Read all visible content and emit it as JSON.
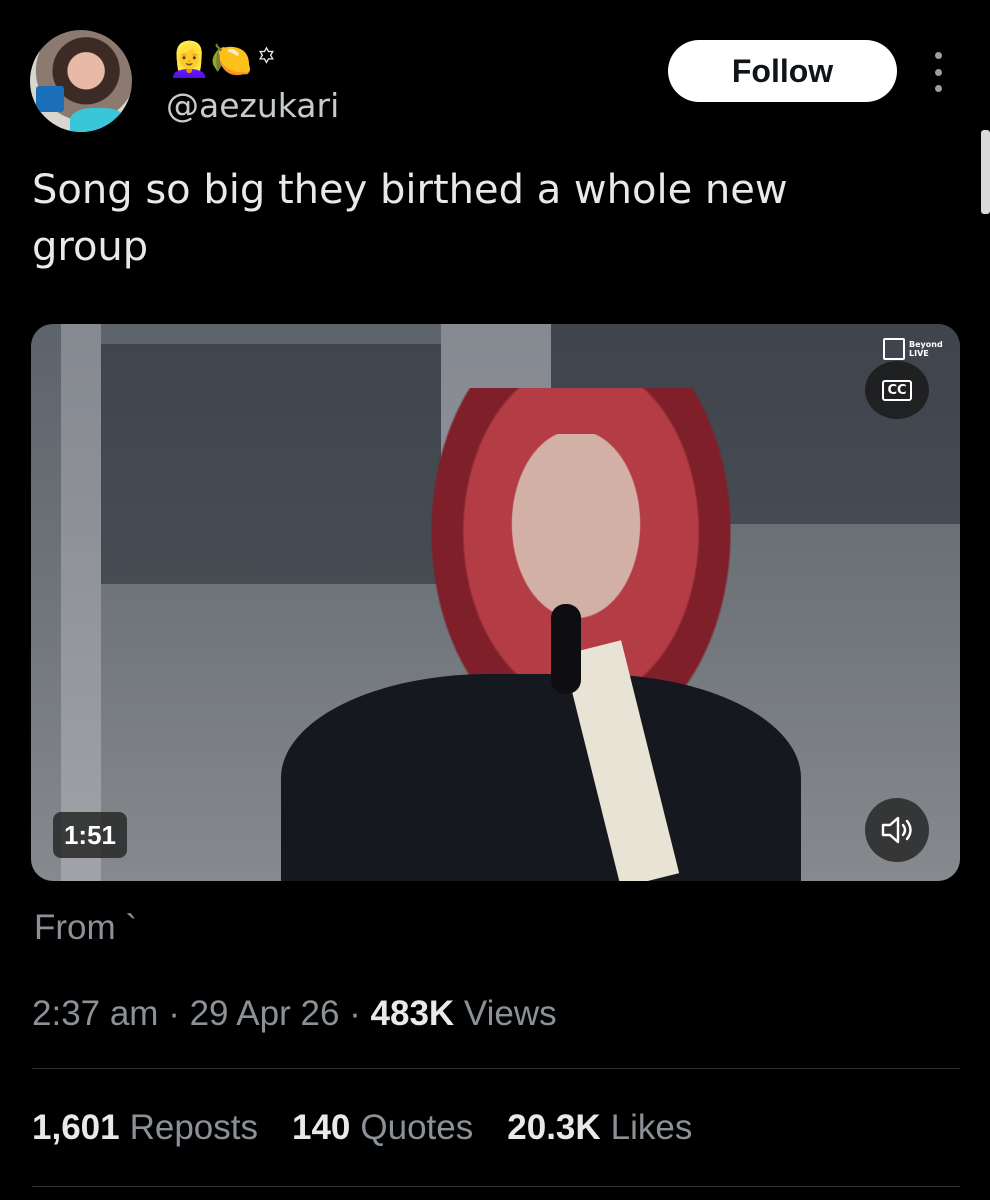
{
  "author": {
    "name_emojis": "👱‍♀️🍋",
    "name_symbol": "꙳",
    "handle": "@aezukari"
  },
  "actions": {
    "follow_label": "Follow"
  },
  "tweet": {
    "text": "Song so big they birthed a whole new group"
  },
  "video": {
    "duration": "1:51",
    "cc_label": "CC",
    "watermark": "Beyond LIVE"
  },
  "source": {
    "from_label": "From `"
  },
  "meta": {
    "time": "2:37 am",
    "sep1": " · ",
    "date": "29 Apr 26",
    "sep2": " · ",
    "views_count": "483K",
    "views_label": " Views"
  },
  "stats": {
    "reposts_count": "1,601",
    "reposts_label": "Reposts",
    "quotes_count": "140",
    "quotes_label": "Quotes",
    "likes_count": "20.3K",
    "likes_label": "Likes"
  },
  "colors": {
    "background": "#000000",
    "text_primary": "#e7e9ea",
    "text_secondary": "#8b9197",
    "button_bg": "#ffffff"
  }
}
